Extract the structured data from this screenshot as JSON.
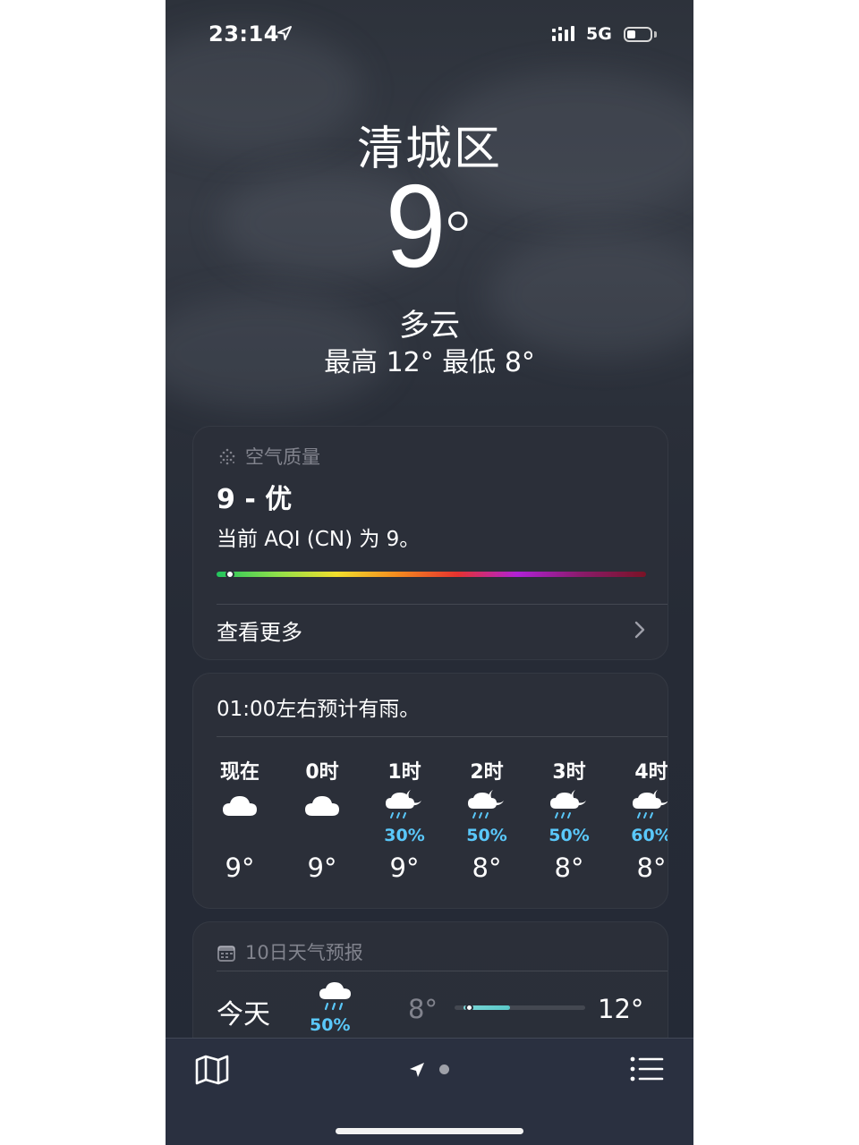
{
  "status_bar": {
    "time": "23:14",
    "network": "5G"
  },
  "location": {
    "city": "清城区"
  },
  "current": {
    "temperature": "9",
    "degree_symbol": "°",
    "condition": "多云",
    "high_low": "最高 12°  最低 8°"
  },
  "air_quality": {
    "header": "空气质量",
    "value": "9 - 优",
    "description": "当前 AQI (CN) 为 9。",
    "bar_position_fraction": 0.02,
    "see_more": "查看更多"
  },
  "hourly": {
    "note": "01:00左右预计有雨。",
    "items": [
      {
        "label": "现在",
        "icon": "cloud-icon",
        "precip": "",
        "temp": "9°"
      },
      {
        "label": "0时",
        "icon": "cloud-icon",
        "precip": "",
        "temp": "9°"
      },
      {
        "label": "1时",
        "icon": "cloud-moon-rain-icon",
        "precip": "30%",
        "temp": "9°"
      },
      {
        "label": "2时",
        "icon": "cloud-moon-rain-icon",
        "precip": "50%",
        "temp": "8°"
      },
      {
        "label": "3时",
        "icon": "cloud-moon-rain-icon",
        "precip": "50%",
        "temp": "8°"
      },
      {
        "label": "4时",
        "icon": "cloud-moon-rain-icon",
        "precip": "60%",
        "temp": "8°"
      }
    ]
  },
  "daily": {
    "header": "10日天气预报",
    "rows": [
      {
        "day": "今天",
        "icon": "cloud-rain-icon",
        "precip": "50%",
        "low": "8°",
        "high": "12°"
      }
    ]
  },
  "colors": {
    "precip": "#5ac8fa",
    "range_fill": "#5ac8c8",
    "background": "#2a2f39"
  }
}
